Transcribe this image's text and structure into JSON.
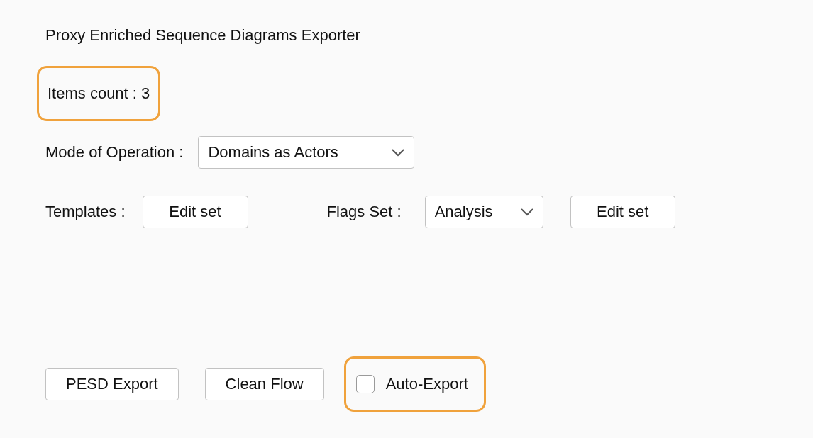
{
  "title": "Proxy Enriched Sequence Diagrams Exporter",
  "items_count": {
    "text": "Items count : 3",
    "highlighted": true
  },
  "mode": {
    "label": "Mode of Operation :",
    "value": "Domains as Actors"
  },
  "templates": {
    "label": "Templates :",
    "button": "Edit set"
  },
  "flags": {
    "label": "Flags Set :",
    "value": "Analysis",
    "button": "Edit set"
  },
  "actions": [
    {
      "kind": "button",
      "label": "PESD Export"
    },
    {
      "kind": "button",
      "label": "Clean Flow"
    },
    {
      "kind": "checkbox",
      "label": "Auto-Export",
      "checked": false,
      "highlighted": true
    }
  ]
}
